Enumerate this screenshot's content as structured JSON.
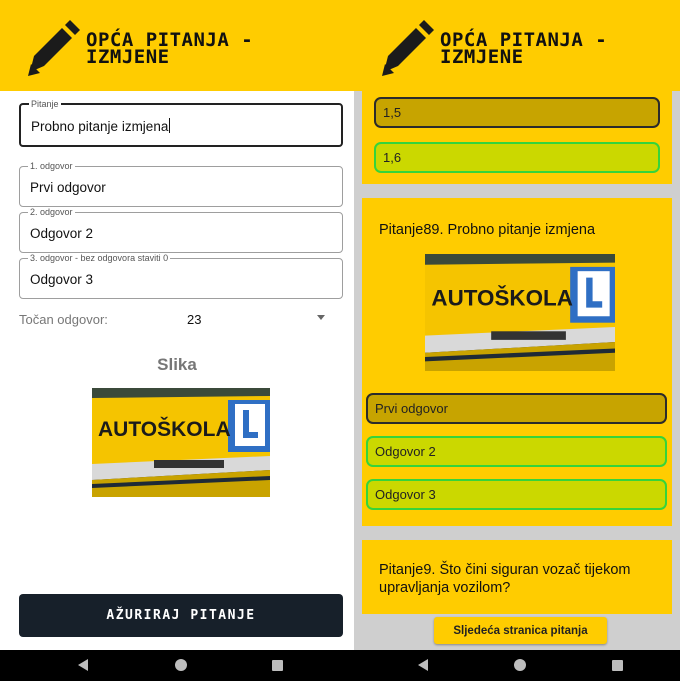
{
  "app_bar": {
    "title_line1": "OPĆA PITANJA -",
    "title_line2": "IZMJENE",
    "icon": "pencil-icon",
    "color": "#ffcc00"
  },
  "edit_form": {
    "question": {
      "label": "Pitanje",
      "value": "Probno pitanje izmjena"
    },
    "answer1": {
      "label": "1. odgovor",
      "value": "Prvi odgovor"
    },
    "answer2": {
      "label": "2. odgovor",
      "value": "Odgovor 2"
    },
    "answer3": {
      "label": "3. odgovor - bez odgovora staviti 0",
      "value": "Odgovor 3"
    },
    "correct_answer": {
      "label": "Točan odgovor:",
      "value": "23"
    },
    "image_section_title": "Slika",
    "image_text": "AUTOŠKOLA",
    "image_badge": "L",
    "update_button": "AŽURIRAJ PITANJE"
  },
  "question_list": {
    "prev_options": [
      {
        "text": "1,5",
        "state": "wrong"
      },
      {
        "text": "1,6",
        "state": "correct"
      }
    ],
    "card89": {
      "title": "Pitanje89. Probno pitanje izmjena",
      "image_text": "AUTOŠKOLA",
      "image_badge": "L",
      "options": [
        {
          "text": "Prvi odgovor",
          "state": "wrong"
        },
        {
          "text": "Odgovor 2",
          "state": "correct"
        },
        {
          "text": "Odgovor 3",
          "state": "correct"
        }
      ]
    },
    "card9": {
      "title_line1": "Pitanje9. Što čini siguran vozač tijekom",
      "title_line2": "upravljanja vozilom?"
    },
    "next_page_button": "Sljedeća stranica pitanja"
  },
  "nav_bar": {
    "back": "back-icon",
    "home": "home-icon",
    "recents": "recents-icon"
  },
  "colors": {
    "accent": "#ffcc00",
    "wrong_fill": "#c7a400",
    "correct_fill": "#cbd800",
    "correct_border": "#35d43b",
    "button_dark": "#17202a"
  }
}
